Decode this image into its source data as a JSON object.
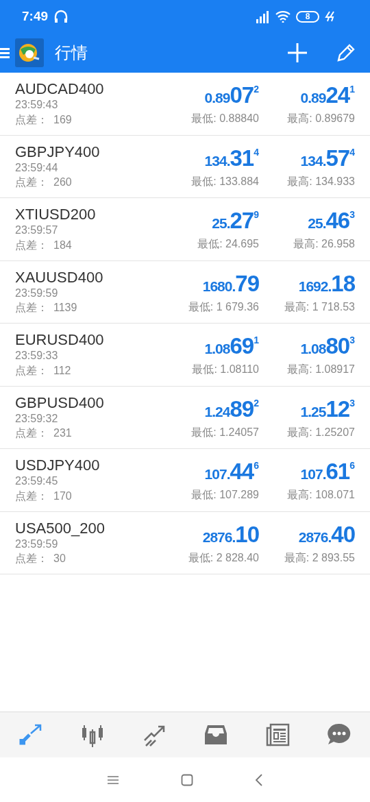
{
  "status_bar": {
    "time": "7:49",
    "battery": "8"
  },
  "app_bar": {
    "title": "行情"
  },
  "quotes": [
    {
      "symbol": "AUDCAD400",
      "time": "23:59:43",
      "spread_label": "点差：",
      "spread": "169",
      "bid": {
        "small": "0.89",
        "big": "07",
        "sup": "2"
      },
      "ask": {
        "small": "0.89",
        "big": "24",
        "sup": "1"
      },
      "low": "最低: 0.88840",
      "high": "最高: 0.89679"
    },
    {
      "symbol": "GBPJPY400",
      "time": "23:59:44",
      "spread_label": "点差：",
      "spread": "260",
      "bid": {
        "small": "134.",
        "big": "31",
        "sup": "4"
      },
      "ask": {
        "small": "134.",
        "big": "57",
        "sup": "4"
      },
      "low": "最低: 133.884",
      "high": "最高: 134.933"
    },
    {
      "symbol": "XTIUSD200",
      "time": "23:59:57",
      "spread_label": "点差：",
      "spread": "184",
      "bid": {
        "small": "25.",
        "big": "27",
        "sup": "9"
      },
      "ask": {
        "small": "25.",
        "big": "46",
        "sup": "3"
      },
      "low": "最低: 24.695",
      "high": "最高: 26.958"
    },
    {
      "symbol": "XAUUSD400",
      "time": "23:59:59",
      "spread_label": "点差：",
      "spread": "1139",
      "bid": {
        "small": "1680.",
        "big": "79"
      },
      "ask": {
        "small": "1692.",
        "big": "18"
      },
      "low": "最低: 1 679.36",
      "high": "最高: 1 718.53"
    },
    {
      "symbol": "EURUSD400",
      "time": "23:59:33",
      "spread_label": "点差：",
      "spread": "112",
      "bid": {
        "small": "1.08",
        "big": "69",
        "sup": "1"
      },
      "ask": {
        "small": "1.08",
        "big": "80",
        "sup": "3"
      },
      "low": "最低: 1.08110",
      "high": "最高: 1.08917"
    },
    {
      "symbol": "GBPUSD400",
      "time": "23:59:32",
      "spread_label": "点差：",
      "spread": "231",
      "bid": {
        "small": "1.24",
        "big": "89",
        "sup": "2"
      },
      "ask": {
        "small": "1.25",
        "big": "12",
        "sup": "3"
      },
      "low": "最低: 1.24057",
      "high": "最高: 1.25207"
    },
    {
      "symbol": "USDJPY400",
      "time": "23:59:45",
      "spread_label": "点差：",
      "spread": "170",
      "bid": {
        "small": "107.",
        "big": "44",
        "sup": "6"
      },
      "ask": {
        "small": "107.",
        "big": "61",
        "sup": "6"
      },
      "low": "最低: 107.289",
      "high": "最高: 108.071"
    },
    {
      "symbol": "USA500_200",
      "time": "23:59:59",
      "spread_label": "点差：",
      "spread": "30",
      "bid": {
        "small": "2876.",
        "big": "10"
      },
      "ask": {
        "small": "2876.",
        "big": "40"
      },
      "low": "最低: 2 828.40",
      "high": "最高: 2 893.55"
    }
  ],
  "bottom_nav": [
    {
      "selected": true
    },
    {
      "selected": false
    },
    {
      "selected": false
    },
    {
      "selected": false
    },
    {
      "selected": false
    },
    {
      "selected": false
    }
  ]
}
